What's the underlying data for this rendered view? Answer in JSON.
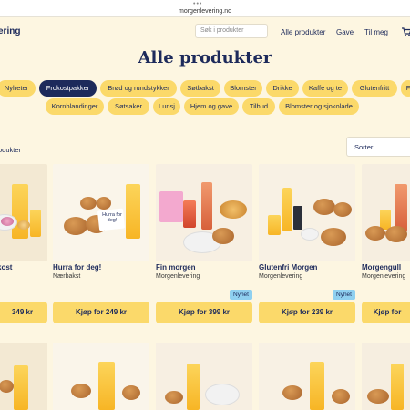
{
  "browser": {
    "url": "morgenlevering.no"
  },
  "nav": {
    "logo_text": "ering",
    "search_placeholder": "Søk i produkter",
    "links": [
      "Alle produkter",
      "Gave",
      "Til meg"
    ]
  },
  "page": {
    "title": "Alle produkter"
  },
  "categories_row1": [
    "Nyheter",
    "Frokostpakker",
    "Brød og rundstykker",
    "Søtbakst",
    "Blomster",
    "Drikke",
    "Kaffe og te",
    "Glutenfritt",
    "F"
  ],
  "categories_row2": [
    "Kornblandinger",
    "Søtsaker",
    "Lunsj",
    "Hjem og gave",
    "Tilbud",
    "Blomster og sjokolade"
  ],
  "active_category": "Frokostpakker",
  "list": {
    "count_label": "odukter",
    "sort_label": "Sorter"
  },
  "products": [
    {
      "name": "kost",
      "category": "",
      "badge": "",
      "buy": "349 kr"
    },
    {
      "name": "Hurra for deg!",
      "category": "Nærbakst",
      "badge": "",
      "buy": "Kjøp for 249 kr",
      "card_text": "Hurra for deg!"
    },
    {
      "name": "Fin morgen",
      "category": "Morgenlevering",
      "badge": "Nyhet",
      "buy": "Kjøp for 399 kr"
    },
    {
      "name": "Glutenfri Morgen",
      "category": "Morgenlevering",
      "badge": "Nyhet",
      "buy": "Kjøp for 239 kr"
    },
    {
      "name": "Morgengull",
      "category": "Morgenlevering",
      "badge": "",
      "buy": "Kjøp for"
    }
  ],
  "colors": {
    "background": "#fdf6e1",
    "accent": "#fbd96a",
    "navy": "#1d2a5b",
    "badge": "#8fd0f0"
  }
}
